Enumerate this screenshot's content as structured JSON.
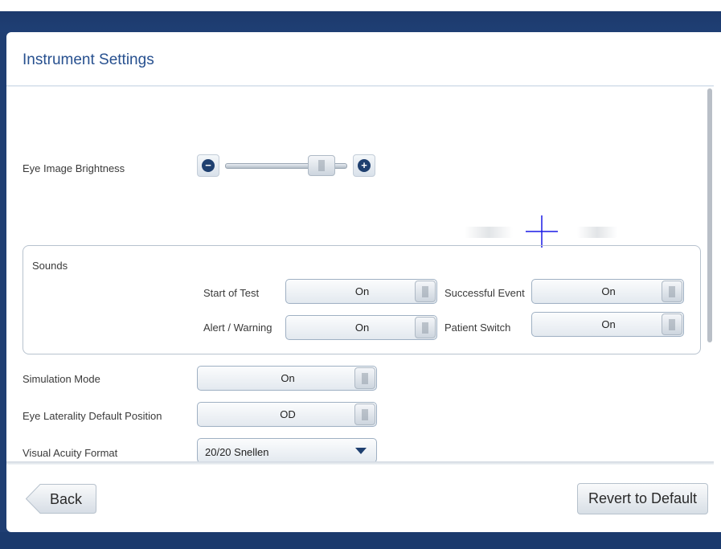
{
  "dialog": {
    "title": "Instrument Settings"
  },
  "eye_image_brightness": {
    "label": "Eye Image Brightness",
    "level_fraction": 0.75
  },
  "sounds": {
    "title": "Sounds",
    "rows": [
      {
        "label": "Start of Test",
        "value": "On"
      },
      {
        "label": "Successful Event",
        "value": "On"
      },
      {
        "label": "Alert / Warning",
        "value": "On"
      },
      {
        "label": "Patient Switch",
        "value": "On"
      }
    ]
  },
  "simulation_mode": {
    "label": "Simulation Mode",
    "value": "On"
  },
  "eye_laterality": {
    "label": "Eye Laterality Default Position",
    "value": "OD"
  },
  "visual_acuity": {
    "label": "Visual Acuity Format",
    "value": "20/20 Snellen"
  },
  "footer": {
    "back_label": "Back",
    "revert_label": "Revert to Default"
  },
  "colors": {
    "accent": "#1e3f6f",
    "title": "#27508f",
    "crosshair": "#1a1ae6"
  },
  "icons": {
    "minus": "minus-circle-icon",
    "plus": "plus-circle-icon",
    "dropdown": "triangle-down-icon",
    "crosshair": "crosshair-icon"
  }
}
